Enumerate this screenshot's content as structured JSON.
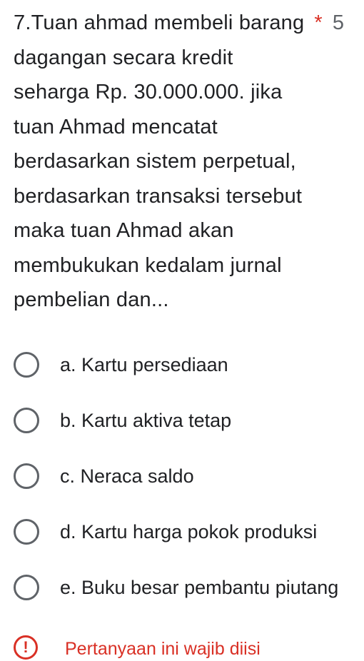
{
  "question": {
    "lines": [
      "7.Tuan ahmad membeli barang",
      "dagangan secara kredit",
      "seharga Rp. 30.000.000. jika",
      "tuan Ahmad mencatat",
      "berdasarkan sistem perpetual,",
      "berdasarkan transaksi tersebut",
      "maka tuan Ahmad akan",
      "membukukan kedalam jurnal",
      "pembelian dan..."
    ],
    "required_marker": "*",
    "points": "5"
  },
  "options": [
    {
      "label": "a. Kartu persediaan",
      "selected": false
    },
    {
      "label": "b. Kartu aktiva tetap",
      "selected": false
    },
    {
      "label": "c. Neraca saldo",
      "selected": false
    },
    {
      "label": "d. Kartu harga pokok produksi",
      "selected": false
    },
    {
      "label": "e. Buku besar pembantu piutang",
      "selected": false
    }
  ],
  "validation": {
    "icon": "exclamation-icon",
    "glyph": "!",
    "message": "Pertanyaan ini wajib diisi"
  },
  "colors": {
    "text": "#202124",
    "radio_border": "#5f6368",
    "error": "#d93025"
  }
}
